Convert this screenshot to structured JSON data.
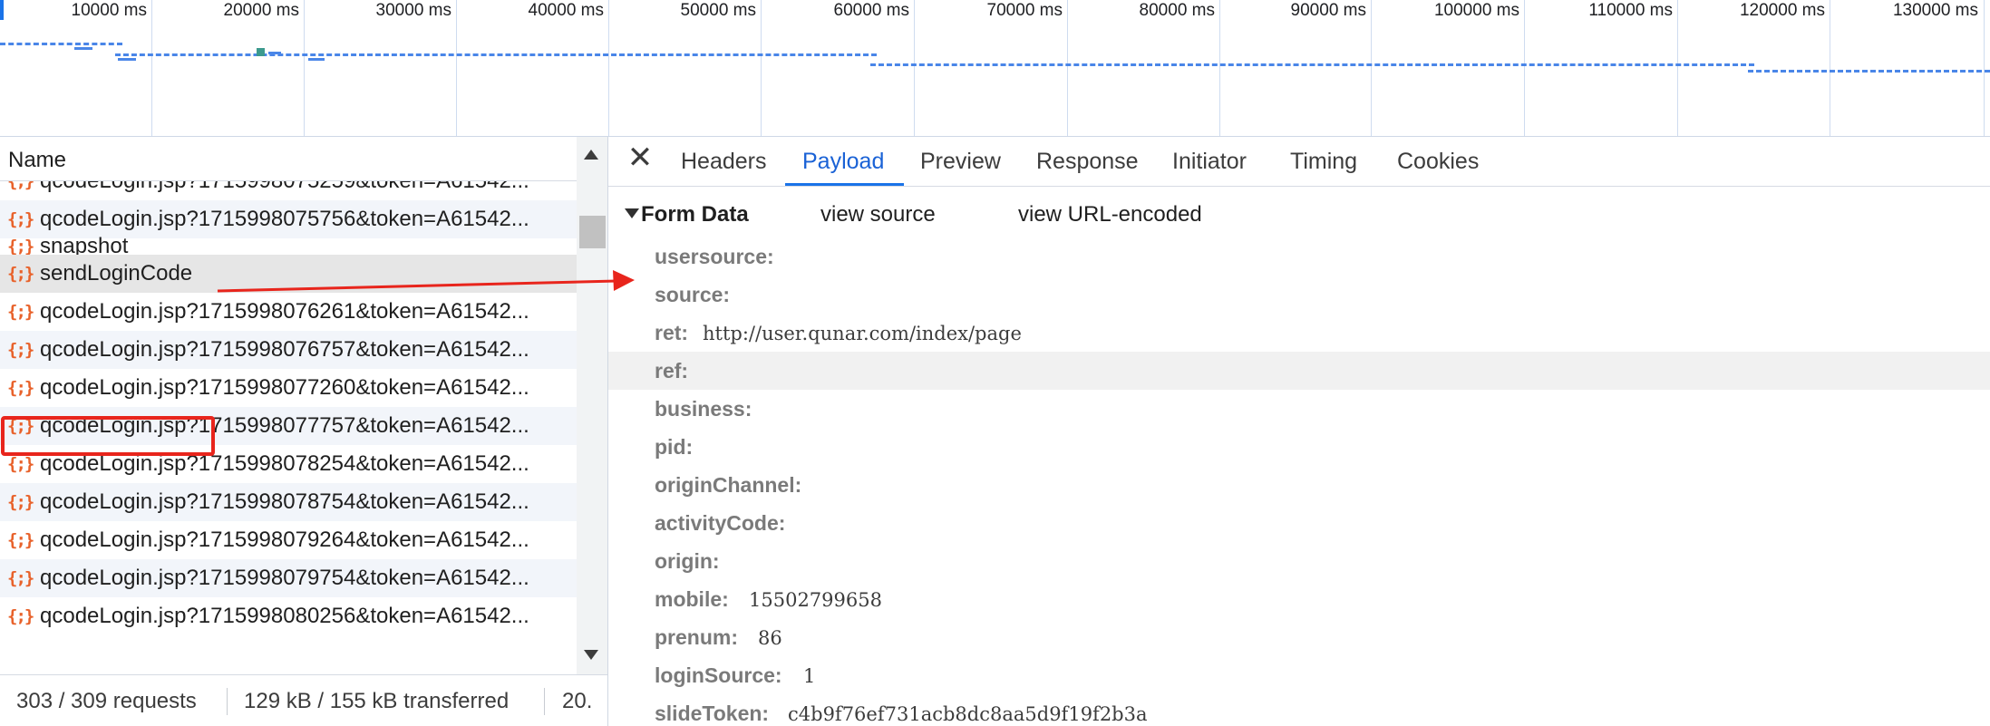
{
  "timeline": {
    "ticks": [
      "10000 ms",
      "20000 ms",
      "30000 ms",
      "40000 ms",
      "50000 ms",
      "60000 ms",
      "70000 ms",
      "80000 ms",
      "90000 ms",
      "100000 ms",
      "110000 ms",
      "120000 ms",
      "130000 ms"
    ]
  },
  "request_list": {
    "header": "Name",
    "icon_glyph": "{;}",
    "rows": [
      {
        "name": "qcodeLogin.jsp?1715998075259&token=A61542..."
      },
      {
        "name": "qcodeLogin.jsp?1715998075756&token=A61542..."
      },
      {
        "name": "snapshot"
      },
      {
        "name": "sendLoginCode"
      },
      {
        "name": "qcodeLogin.jsp?1715998076261&token=A61542..."
      },
      {
        "name": "qcodeLogin.jsp?1715998076757&token=A61542..."
      },
      {
        "name": "qcodeLogin.jsp?1715998077260&token=A61542..."
      },
      {
        "name": "qcodeLogin.jsp?1715998077757&token=A61542..."
      },
      {
        "name": "qcodeLogin.jsp?1715998078254&token=A61542..."
      },
      {
        "name": "qcodeLogin.jsp?1715998078754&token=A61542..."
      },
      {
        "name": "qcodeLogin.jsp?1715998079264&token=A61542..."
      },
      {
        "name": "qcodeLogin.jsp?1715998079754&token=A61542..."
      },
      {
        "name": "qcodeLogin.jsp?1715998080256&token=A61542..."
      }
    ],
    "status": {
      "requests": "303 / 309 requests",
      "transferred": "129 kB / 155 kB transferred",
      "extra": "20."
    }
  },
  "detail": {
    "close_glyph": "✕",
    "tabs": [
      "Headers",
      "Payload",
      "Preview",
      "Response",
      "Initiator",
      "Timing",
      "Cookies"
    ],
    "active_tab": "Payload",
    "section_title": "Form Data",
    "view_source": "view source",
    "view_url_encoded": "view URL-encoded",
    "fields": [
      {
        "key": "usersource:",
        "value": ""
      },
      {
        "key": "source:",
        "value": ""
      },
      {
        "key": "ret:",
        "value": "http://user.qunar.com/index/page"
      },
      {
        "key": "ref:",
        "value": ""
      },
      {
        "key": "business:",
        "value": ""
      },
      {
        "key": "pid:",
        "value": ""
      },
      {
        "key": "originChannel:",
        "value": ""
      },
      {
        "key": "activityCode:",
        "value": ""
      },
      {
        "key": "origin:",
        "value": ""
      },
      {
        "key": "mobile:",
        "value": "15502799658"
      },
      {
        "key": "prenum:",
        "value": "86"
      },
      {
        "key": "loginSource:",
        "value": "1"
      },
      {
        "key": "slideToken:",
        "value": "c4b9f76ef731acb8dc8aa5d9f19f2b3a"
      }
    ]
  },
  "colors": {
    "accent": "#1a73e8",
    "highlight_annotation": "#e8251c",
    "icon_orange": "#e8622b"
  }
}
